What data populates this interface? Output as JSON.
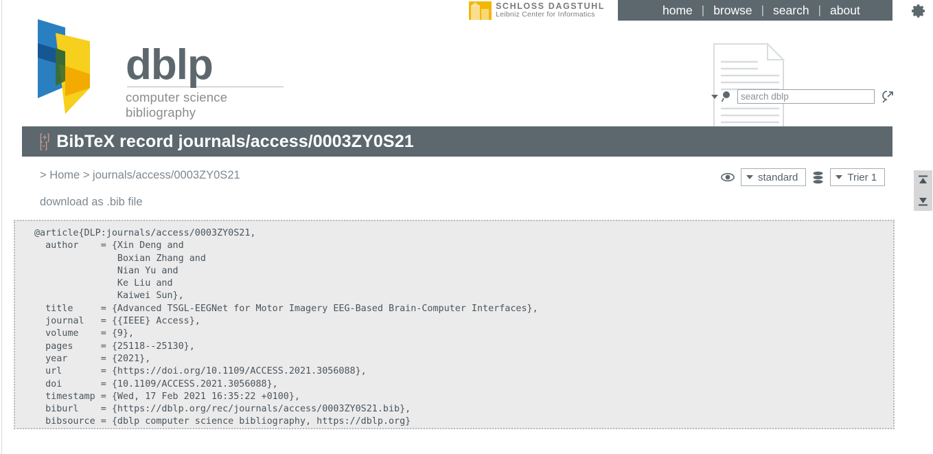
{
  "nav": {
    "items": [
      {
        "label": "home"
      },
      {
        "label": "browse"
      },
      {
        "label": "search"
      },
      {
        "label": "about"
      }
    ],
    "separator": "|",
    "gear_icon": "gear-icon",
    "bar_color": "#5d686e"
  },
  "dagstuhl": {
    "line1": "SCHLOSS DAGSTUHL",
    "line2": "Leibniz Center for Informatics",
    "logo_color": "#f2b705"
  },
  "brand": {
    "wordmark": "dblp",
    "tagline": "computer science bibliography",
    "colors": {
      "blue": "#2a7fc1",
      "dark_blue": "#15538f",
      "yellow": "#f7cf1d",
      "gold": "#f2a900",
      "green": "#3d6b2e",
      "gray": "#5d686e"
    }
  },
  "search": {
    "placeholder": "search dblp",
    "value": "",
    "caret_icon": "chevron-down-icon",
    "magnifier_icon": "search-icon",
    "advanced_icon": "search-options-icon",
    "watermark_icon": "document-page-icon"
  },
  "page": {
    "title": "BibTeX record journals/access/0003ZY0S21",
    "expand_label": "[+]",
    "collapse_label": "[-]",
    "title_bar_color": "#5d686e",
    "toggle_color": "#e8a398"
  },
  "breadcrumb": {
    "prefix": ">",
    "home": "Home",
    "separator": ">",
    "current": "journals/access/0003ZY0S21",
    "full_text": "> Home > journals/access/0003ZY0S21"
  },
  "download": {
    "label": "download as .bib file"
  },
  "toolbar": {
    "view_icon": "eye-icon",
    "view_select": {
      "value": "standard",
      "caret_icon": "chevron-down-icon"
    },
    "mirror_icon": "database-stack-icon",
    "mirror_select": {
      "value": "Trier 1",
      "caret_icon": "chevron-down-icon"
    }
  },
  "scrollnav": {
    "top_icon": "scroll-to-top-icon",
    "bottom_icon": "scroll-to-bottom-icon"
  },
  "bibtex": {
    "record": "@article{DLP:journals/access/0003ZY0S21,\n  author    = {Xin Deng and\n               Boxian Zhang and\n               Nian Yu and\n               Ke Liu and\n               Kaiwei Sun},\n  title     = {Advanced TSGL-EEGNet for Motor Imagery EEG-Based Brain-Computer Interfaces},\n  journal   = {{IEEE} Access},\n  volume    = {9},\n  pages     = {25118--25130},\n  year      = {2021},\n  url       = {https://doi.org/10.1109/ACCESS.2021.3056088},\n  doi       = {10.1109/ACCESS.2021.3056088},\n  timestamp = {Wed, 17 Feb 2021 16:35:22 +0100},\n  biburl    = {https://dblp.org/rec/journals/access/0003ZY0S21.bib},\n  bibsource = {dblp computer science bibliography, https://dblp.org}\n}",
    "fields": {
      "entry_type": "@article",
      "key": "DBLP:journals/access/0003ZY0S21",
      "authors": [
        "Xin Deng",
        "Boxian Zhang",
        "Nian Yu",
        "Ke Liu",
        "Kaiwei Sun"
      ],
      "title": "Advanced TSGL-EEGNet for Motor Imagery EEG-Based Brain-Computer Interfaces",
      "journal": "{IEEE} Access",
      "volume": "9",
      "pages": "25118--25130",
      "year": "2021",
      "url": "https://doi.org/10.1109/ACCESS.2021.3056088",
      "doi": "10.1109/ACCESS.2021.3056088",
      "timestamp": "Wed, 17 Feb 2021 16:35:22 +0100",
      "biburl": "https://dblp.org/rec/journals/access/0003ZY0S21.bib",
      "bibsource": "dblp computer science bibliography, https://dblp.org"
    }
  }
}
